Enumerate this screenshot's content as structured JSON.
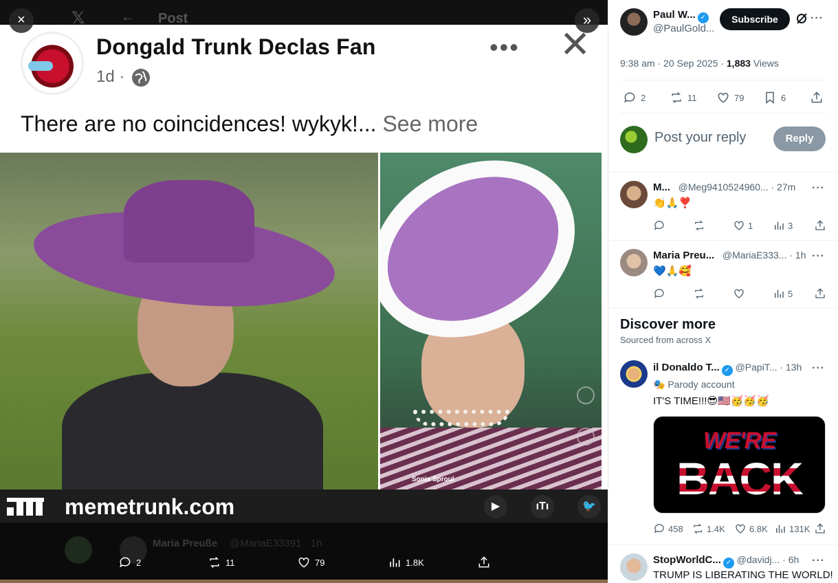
{
  "viewer": {
    "bg_title": "Post",
    "bg_reply_name": "Maria Preuße",
    "bg_reply_handle": "@MariaE33391 · 1h",
    "close_label": "×",
    "expand_label": "»"
  },
  "fb_post": {
    "name": "Dongald Trunk Declas Fan",
    "time": "1d ·",
    "text": "There are no coincidences! wykyk!...",
    "see_more": "See more",
    "watermark": "memetrunk.com",
    "photo_credit": "Sonia Sproul"
  },
  "media_actions": {
    "replies": "2",
    "reposts": "11",
    "likes": "79",
    "views": "1.8K"
  },
  "sidebar": {
    "author": {
      "name": "Paul W...",
      "handle": "@PaulGold...",
      "subscribe_label": "Subscribe"
    },
    "meta": {
      "time": "9:38 am · 20 Sep 2025 ·",
      "views_count": "1,883",
      "views_label": "Views"
    },
    "actions": {
      "replies": "2",
      "reposts": "11",
      "likes": "79",
      "bookmarks": "6"
    },
    "reply_box": {
      "placeholder": "Post your reply",
      "button": "Reply"
    },
    "replies": [
      {
        "name": "M...",
        "handle": "@Meg9410524960...",
        "time": "· 27m",
        "text": "👏🙏❣️",
        "likes": "1",
        "views": "3"
      },
      {
        "name": "Maria Preu...",
        "handle": "@MariaE333...",
        "time": "· 1h",
        "text": "💙🙏🥰",
        "likes": "",
        "views": "5"
      }
    ],
    "discover": {
      "title": "Discover more",
      "subtitle": "Sourced from across X"
    },
    "suggested": [
      {
        "name": "il Donaldo T...",
        "handle": "@PapiT...",
        "time": "· 13h",
        "label": "Parody account",
        "text": "IT'S TIME!!!😎🇺🇸🥳🥳🥳",
        "image_line1": "WE'RE",
        "image_line2": "BACK",
        "replies": "458",
        "reposts": "1.4K",
        "likes": "6.8K",
        "views": "131K"
      },
      {
        "name": "StopWorldC...",
        "handle": "@davidj...",
        "time": "· 6h",
        "text": "TRUMP IS LIBERATING THE WORLD!"
      }
    ]
  }
}
